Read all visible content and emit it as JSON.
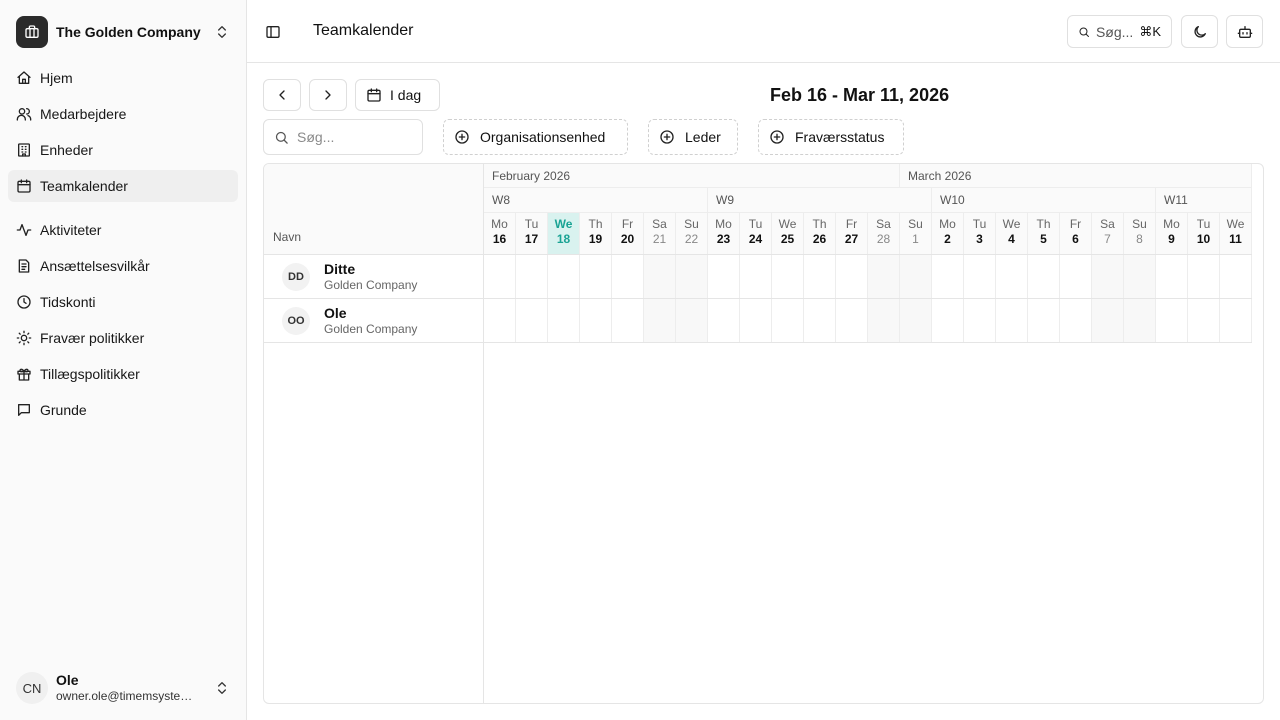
{
  "sidebar": {
    "company_name": "The Golden Company",
    "items": [
      {
        "label": "Hjem",
        "icon": "home-icon"
      },
      {
        "label": "Medarbejdere",
        "icon": "users-icon"
      },
      {
        "label": "Enheder",
        "icon": "building-icon"
      },
      {
        "label": "Teamkalender",
        "icon": "calendar-icon",
        "active": true
      },
      {
        "label": "Aktiviteter",
        "icon": "activity-icon"
      },
      {
        "label": "Ansættelsesvilkår",
        "icon": "document-icon"
      },
      {
        "label": "Tidskonti",
        "icon": "clock-icon"
      },
      {
        "label": "Fravær politikker",
        "icon": "sun-icon"
      },
      {
        "label": "Tillægspolitikker",
        "icon": "gift-icon"
      },
      {
        "label": "Grunde",
        "icon": "message-icon"
      }
    ],
    "user": {
      "initials": "CN",
      "name": "Ole",
      "email": "owner.ole@timemsystem.dk"
    }
  },
  "header": {
    "title": "Teamkalender",
    "search_label": "Søg...",
    "search_shortcut": "⌘K"
  },
  "toolbar": {
    "today_label": "I dag",
    "range": "Feb 16 - Mar 11, 2026",
    "search_placeholder": "Søg...",
    "filters": [
      "Organisationsenhed",
      "Leder",
      "Fraværsstatus"
    ]
  },
  "calendar": {
    "name_header": "Navn",
    "months": [
      {
        "label": "February 2026",
        "days": 13
      },
      {
        "label": "March 2026",
        "days": 11
      }
    ],
    "weeks": [
      {
        "label": "W8",
        "days": 7
      },
      {
        "label": "W9",
        "days": 7
      },
      {
        "label": "W10",
        "days": 7
      },
      {
        "label": "W11",
        "days": 3
      }
    ],
    "days": [
      {
        "dn": "Mo",
        "dd": "16"
      },
      {
        "dn": "Tu",
        "dd": "17"
      },
      {
        "dn": "We",
        "dd": "18",
        "today": true
      },
      {
        "dn": "Th",
        "dd": "19"
      },
      {
        "dn": "Fr",
        "dd": "20"
      },
      {
        "dn": "Sa",
        "dd": "21",
        "weekend": true
      },
      {
        "dn": "Su",
        "dd": "22",
        "weekend": true
      },
      {
        "dn": "Mo",
        "dd": "23"
      },
      {
        "dn": "Tu",
        "dd": "24"
      },
      {
        "dn": "We",
        "dd": "25"
      },
      {
        "dn": "Th",
        "dd": "26"
      },
      {
        "dn": "Fr",
        "dd": "27"
      },
      {
        "dn": "Sa",
        "dd": "28",
        "weekend": true
      },
      {
        "dn": "Su",
        "dd": "1",
        "weekend": true
      },
      {
        "dn": "Mo",
        "dd": "2"
      },
      {
        "dn": "Tu",
        "dd": "3"
      },
      {
        "dn": "We",
        "dd": "4"
      },
      {
        "dn": "Th",
        "dd": "5"
      },
      {
        "dn": "Fr",
        "dd": "6"
      },
      {
        "dn": "Sa",
        "dd": "7",
        "weekend": true
      },
      {
        "dn": "Su",
        "dd": "8",
        "weekend": true
      },
      {
        "dn": "Mo",
        "dd": "9"
      },
      {
        "dn": "Tu",
        "dd": "10"
      },
      {
        "dn": "We",
        "dd": "11"
      }
    ],
    "people": [
      {
        "initials": "DD",
        "name": "Ditte",
        "unit": "Golden Company"
      },
      {
        "initials": "OO",
        "name": "Ole",
        "unit": "Golden Company"
      }
    ]
  },
  "colors": {
    "today_bg": "#d9f2ef",
    "today_text": "#1aa394",
    "sidebar_bg": "#fafafa"
  }
}
